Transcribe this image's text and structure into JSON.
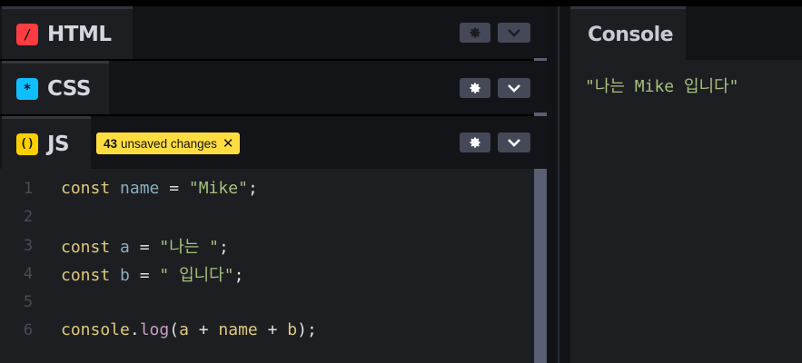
{
  "panels": {
    "html": {
      "label": "HTML",
      "icon": "/"
    },
    "css": {
      "label": "CSS",
      "icon": "*"
    },
    "js": {
      "label": "JS",
      "icon": "()"
    }
  },
  "unsaved": {
    "count": "43",
    "text": "unsaved changes",
    "close": "✕"
  },
  "editor": {
    "line_numbers": [
      "1",
      "2",
      "3",
      "4",
      "5",
      "6"
    ],
    "lines": [
      {
        "kw": "const",
        "var": "name",
        "op": " = ",
        "str": "\"Mike\"",
        "end": ";"
      },
      {},
      {
        "kw": "const",
        "var": "a",
        "op": " = ",
        "str": "\"나는 \"",
        "end": ";"
      },
      {
        "kw": "const",
        "var": "b",
        "op": " = ",
        "str": "\" 입니다\"",
        "end": ";"
      },
      {},
      {
        "kw": "console",
        "dot": ".",
        "fn": "log",
        "args_open": "(",
        "a1": "a",
        "p1": " + ",
        "a2": "name",
        "p2": " + ",
        "a3": "b",
        "args_close": ");"
      }
    ]
  },
  "console": {
    "title": "Console",
    "output": "\"나는 Mike 입니다\""
  },
  "colors": {
    "html_icon": "#ff3c41",
    "css_icon": "#0ebeff",
    "js_icon": "#fcd000",
    "badge": "#ffdd40"
  },
  "icons": {
    "settings": "gear-icon",
    "collapse": "chevron-down-icon",
    "close": "close-icon"
  }
}
